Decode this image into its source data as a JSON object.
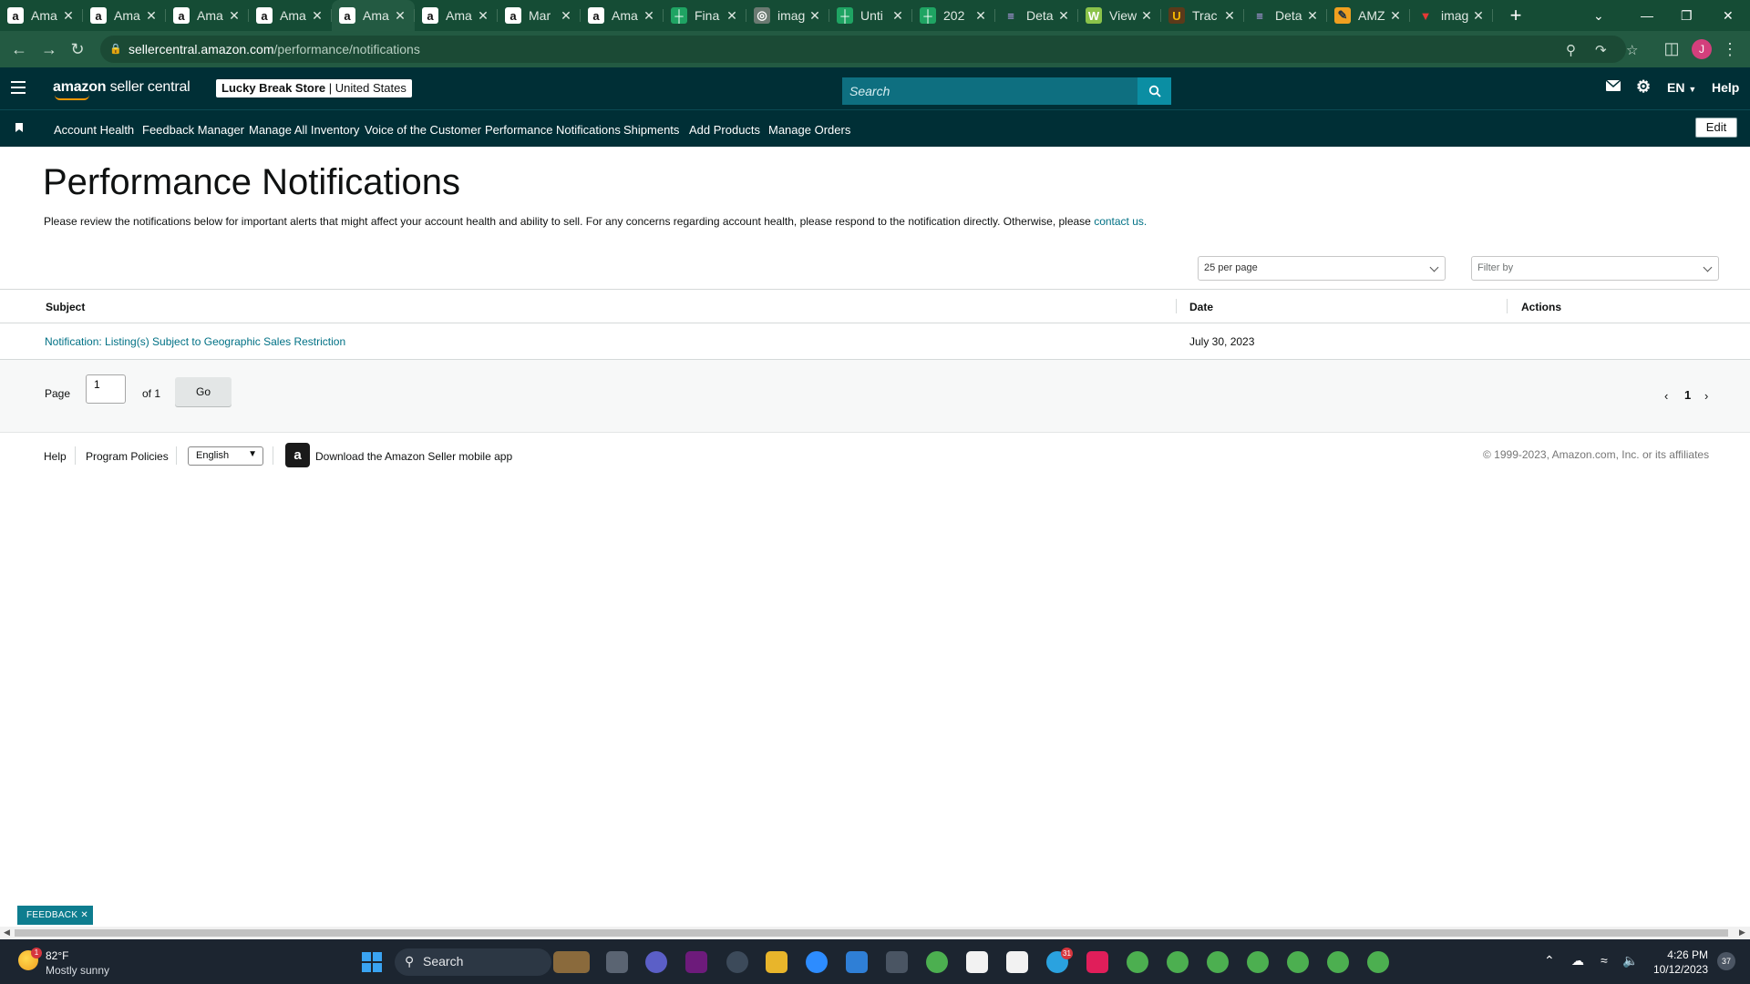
{
  "browser": {
    "tabs": [
      {
        "title": "Ama",
        "favicon": "amazon-icon"
      },
      {
        "title": "Ama",
        "favicon": "amazon-icon"
      },
      {
        "title": "Ama",
        "favicon": "amazon-icon"
      },
      {
        "title": "Ama",
        "favicon": "amazon-icon"
      },
      {
        "title": "Ama",
        "favicon": "amazon-icon",
        "active": true
      },
      {
        "title": "Ama",
        "favicon": "amazon-icon"
      },
      {
        "title": "Mar",
        "favicon": "amazon-icon"
      },
      {
        "title": "Ama",
        "favicon": "amazon-icon"
      },
      {
        "title": "Fina",
        "favicon": "sheets-icon"
      },
      {
        "title": "imag",
        "favicon": "globe-icon"
      },
      {
        "title": "Unti",
        "favicon": "sheets-icon"
      },
      {
        "title": "202",
        "favicon": "sheets-icon"
      },
      {
        "title": "Deta",
        "favicon": "chart-icon"
      },
      {
        "title": "View",
        "favicon": "w-icon"
      },
      {
        "title": "Trac",
        "favicon": "ups-icon"
      },
      {
        "title": "Deta",
        "favicon": "chart-icon"
      },
      {
        "title": "AMZ",
        "favicon": "pen-icon"
      },
      {
        "title": "imag",
        "favicon": "t-icon"
      }
    ],
    "url_host": "sellercentral.amazon.com",
    "url_path": "/performance/notifications",
    "profile_initial": "J"
  },
  "header": {
    "logo_brand": "amazon",
    "logo_product": " seller central",
    "store_name": "Lucky Break Store",
    "store_sep": " | ",
    "store_region": "United States",
    "search_placeholder": "Search",
    "language": "EN",
    "help": "Help"
  },
  "nav": {
    "links": [
      "Account Health",
      "Feedback Manager",
      "Manage All Inventory",
      "Voice of the Customer",
      "Performance Notifications",
      "Shipments",
      "Add Products",
      "Manage Orders"
    ],
    "edit": "Edit"
  },
  "main": {
    "title": "Performance Notifications",
    "intro": "Please review the notifications below for important alerts that might affect your account health and ability to sell. For any concerns regarding account health, please respond to the notification directly. Otherwise, please ",
    "intro_link": "contact us.",
    "per_page": "25 per page",
    "filter_placeholder": "Filter by",
    "table": {
      "columns": [
        "Subject",
        "Date",
        "Actions"
      ],
      "rows": [
        {
          "subject": "Notification: Listing(s) Subject to Geographic Sales Restriction",
          "date": "July 30, 2023",
          "actions": ""
        }
      ]
    },
    "pagination": {
      "page_label": "Page",
      "page_value": "1",
      "of_label": "of 1",
      "go": "Go",
      "current": "1"
    }
  },
  "footer": {
    "help": "Help",
    "policies": "Program Policies",
    "language": "English",
    "app_text": "Download the Amazon Seller mobile app",
    "copyright": "© 1999-2023, Amazon.com, Inc. or its affiliates"
  },
  "feedback": "FEEDBACK",
  "taskbar": {
    "temperature": "82°F",
    "condition": "Mostly sunny",
    "weather_badge": "1",
    "search": "Search",
    "time": "4:26 PM",
    "date": "10/12/2023",
    "notifications": "37"
  },
  "colors": {
    "chrome_tabstrip": "#154c35",
    "seller_header": "#002f36",
    "link": "#007185",
    "search_field": "#0e6f80"
  }
}
